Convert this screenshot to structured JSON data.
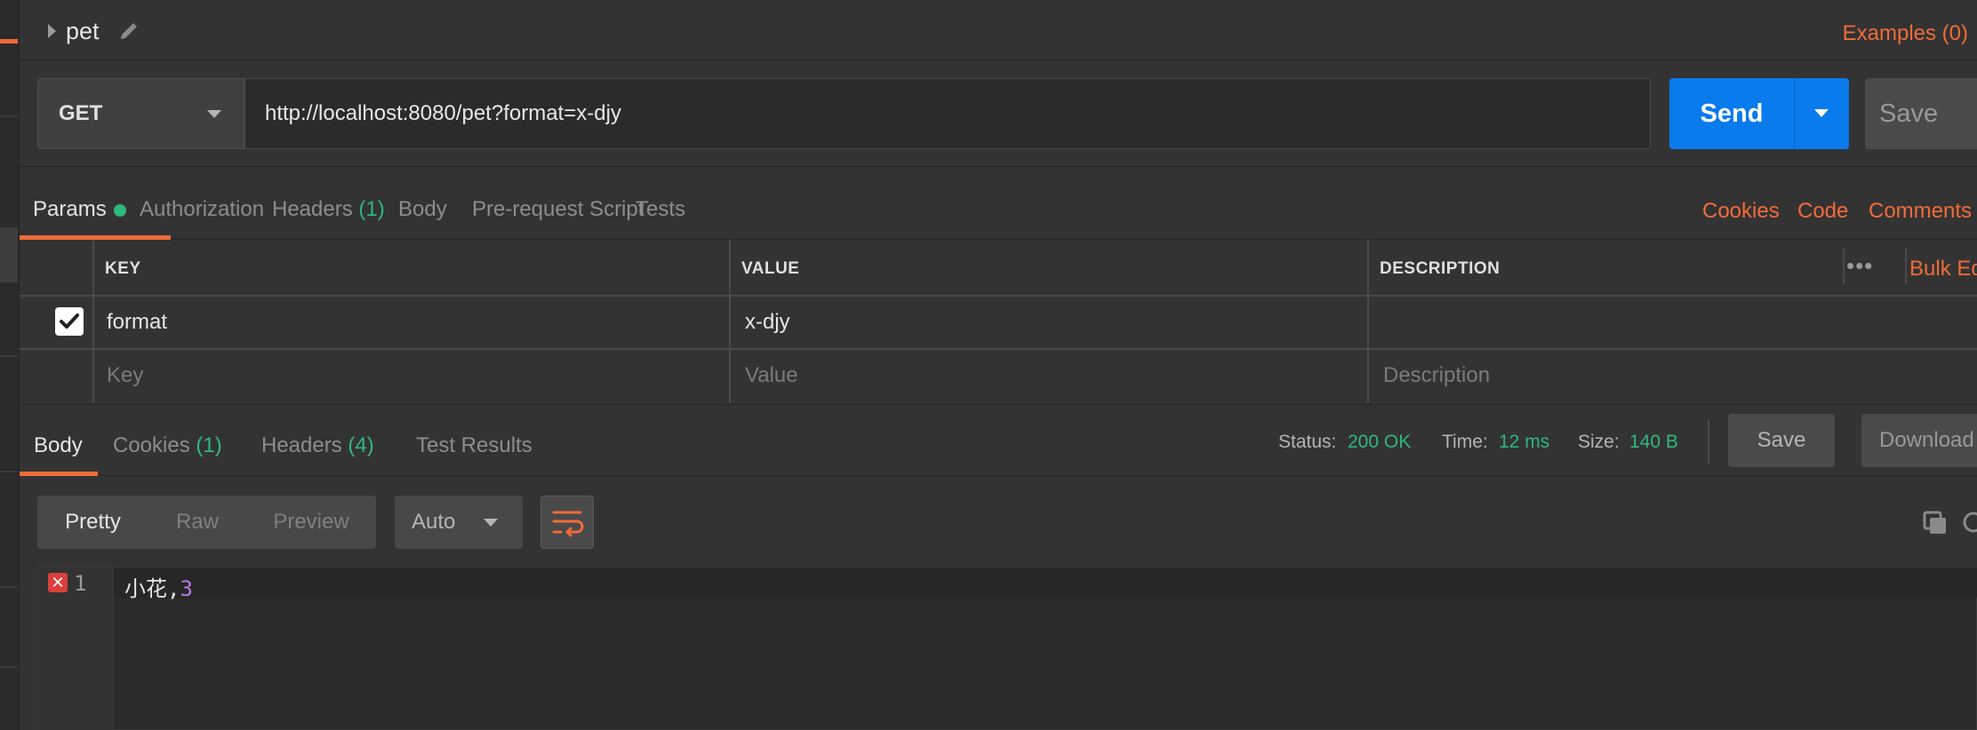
{
  "request": {
    "name": "pet",
    "examples_label": "Examples (0)",
    "method": "GET",
    "url": "http://localhost:8080/pet?format=x-djy",
    "send_label": "Send",
    "save_label": "Save"
  },
  "tabs": {
    "params": "Params",
    "authorization": "Authorization",
    "headers": "Headers",
    "headers_count": "(1)",
    "body": "Body",
    "pre_request": "Pre-request Script",
    "tests": "Tests",
    "cookies": "Cookies",
    "code": "Code",
    "comments": "Comments"
  },
  "params": {
    "columns": {
      "key": "KEY",
      "value": "VALUE",
      "description": "DESCRIPTION"
    },
    "bulk_edit": "Bulk Edit",
    "rows": [
      {
        "enabled": true,
        "key": "format",
        "value": "x-djy",
        "description": ""
      }
    ],
    "placeholders": {
      "key": "Key",
      "value": "Value",
      "description": "Description"
    }
  },
  "response": {
    "tabs": {
      "body": "Body",
      "cookies": "Cookies",
      "cookies_count": "(1)",
      "headers": "Headers",
      "headers_count": "(4)",
      "test_results": "Test Results"
    },
    "status_label": "Status:",
    "status_value": "200 OK",
    "time_label": "Time:",
    "time_value": "12 ms",
    "size_label": "Size:",
    "size_value": "140 B",
    "save_label": "Save",
    "download_label": "Download",
    "view_modes": [
      "Pretty",
      "Raw",
      "Preview"
    ],
    "format": "Auto",
    "body_lines": [
      {
        "number": "1",
        "text": "小花,",
        "value": "3"
      }
    ]
  },
  "colors": {
    "accent": "#f26b3a",
    "primary": "#097bed",
    "success": "#2fb87b"
  }
}
